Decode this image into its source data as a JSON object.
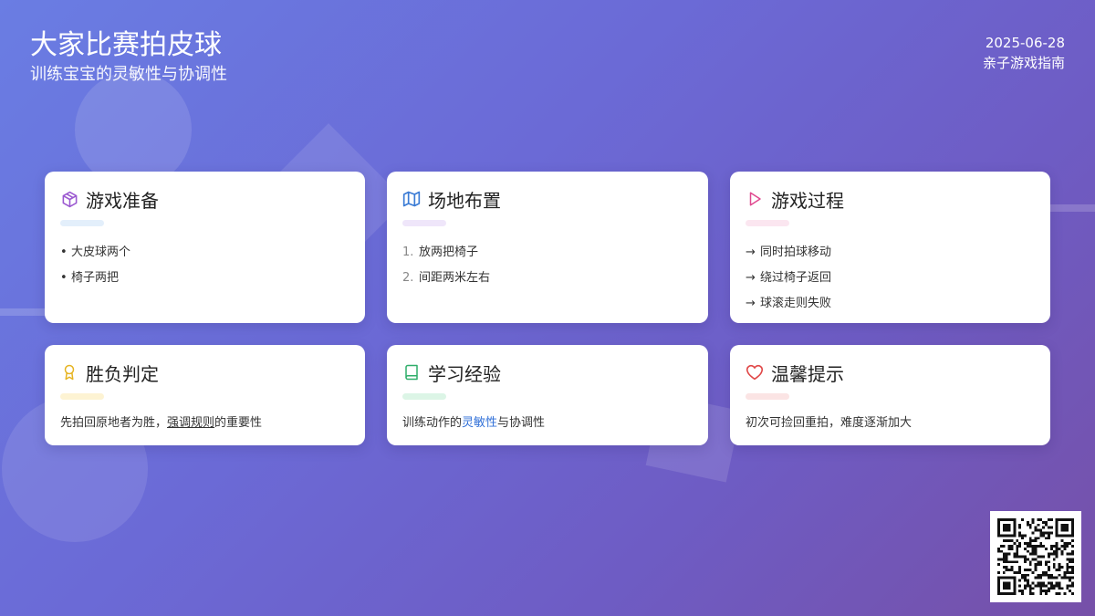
{
  "header": {
    "title": "大家比赛拍皮球",
    "subtitle": "训练宝宝的灵敏性与协调性",
    "date": "2025-06-28",
    "category": "亲子游戏指南"
  },
  "colors": {
    "purple": "#9b59d0",
    "blue": "#3a7bd5",
    "pink": "#e0488f",
    "yellow": "#e6b422",
    "green": "#2fae6a",
    "red": "#e04848"
  },
  "cards": {
    "prep": {
      "icon": "box-icon",
      "title": "游戏准备",
      "items": [
        "大皮球两个",
        "椅子两把"
      ]
    },
    "field": {
      "icon": "map-icon",
      "title": "场地布置",
      "items": [
        {
          "n": "1.",
          "t": "放两把椅子"
        },
        {
          "n": "2.",
          "t": "间距两米左右"
        }
      ]
    },
    "process": {
      "icon": "play-icon",
      "title": "游戏过程",
      "arrow": "→",
      "items": [
        "同时拍球移动",
        "绕过椅子返回",
        "球滚走则失败"
      ]
    },
    "judge": {
      "icon": "award-icon",
      "title": "胜负判定",
      "text_a": "先拍回原地者为胜，",
      "text_b": "强调规则",
      "text_c": "的重要性"
    },
    "learn": {
      "icon": "book-icon",
      "title": "学习经验",
      "text_a": "训练动作的",
      "text_b": "灵敏性",
      "text_c": "与协调性"
    },
    "tips": {
      "icon": "heart-icon",
      "title": "温馨提示",
      "text": "初次可捡回重拍，难度逐渐加大"
    }
  },
  "qr": {
    "icon": "qr-code-icon"
  }
}
